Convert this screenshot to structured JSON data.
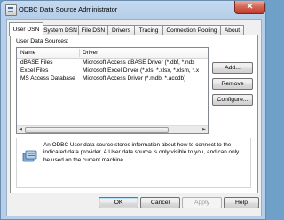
{
  "window": {
    "title": "ODBC Data Source Administrator",
    "close_glyph": "✕"
  },
  "tabs": [
    "User DSN",
    "System DSN",
    "File DSN",
    "Drivers",
    "Tracing",
    "Connection Pooling",
    "About"
  ],
  "user_dsn": {
    "section_label": "User Data Sources:",
    "columns": {
      "name": "Name",
      "driver": "Driver"
    },
    "rows": [
      {
        "name": "dBASE Files",
        "driver": "Microsoft Access dBASE Driver (*.dbf, *.ndx"
      },
      {
        "name": "Excel Files",
        "driver": "Microsoft Excel Driver (*.xls, *.xlsx, *.xlsm, *.x"
      },
      {
        "name": "MS Access Database",
        "driver": "Microsoft Access Driver (*.mdb, *.accdb)"
      }
    ],
    "buttons": {
      "add": "Add...",
      "remove": "Remove",
      "configure": "Configure..."
    },
    "info_text": "An ODBC User data source stores information about how to connect to the indicated data provider.   A User data source is only visible to you, and can only be used on the current machine."
  },
  "footer": {
    "ok": "OK",
    "cancel": "Cancel",
    "apply": "Apply",
    "help": "Help"
  },
  "scroll": {
    "left_glyph": "◀",
    "right_glyph": "▶"
  }
}
